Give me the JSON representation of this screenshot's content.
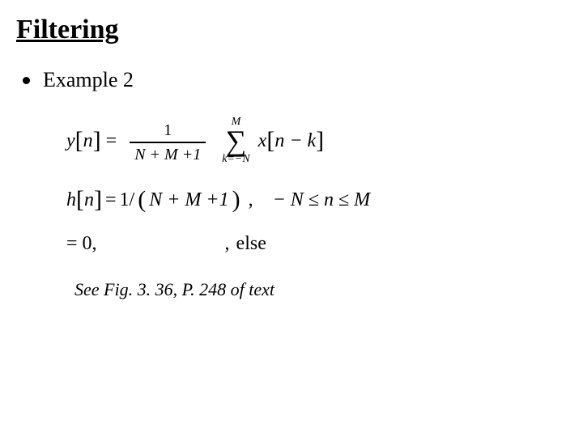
{
  "title": "Filtering",
  "bullet": {
    "label": "Example 2"
  },
  "eq1": {
    "y": "y",
    "n": "n",
    "eq": "=",
    "frac_num": "1",
    "frac_den": "N + M +1",
    "sum_upper": "M",
    "sum_lower": "k=−N",
    "x": "x",
    "arg": "n − k"
  },
  "eq2": {
    "h": "h",
    "n": "n",
    "eq": "=",
    "oneover": "1/",
    "inside": "N + M +1",
    "comma": ",",
    "range": "− N ≤ n ≤ M"
  },
  "eq3": {
    "lhs": "= 0,",
    "comma": ",",
    "else": "else"
  },
  "footnote": "See Fig. 3. 36, P. 248 of text"
}
